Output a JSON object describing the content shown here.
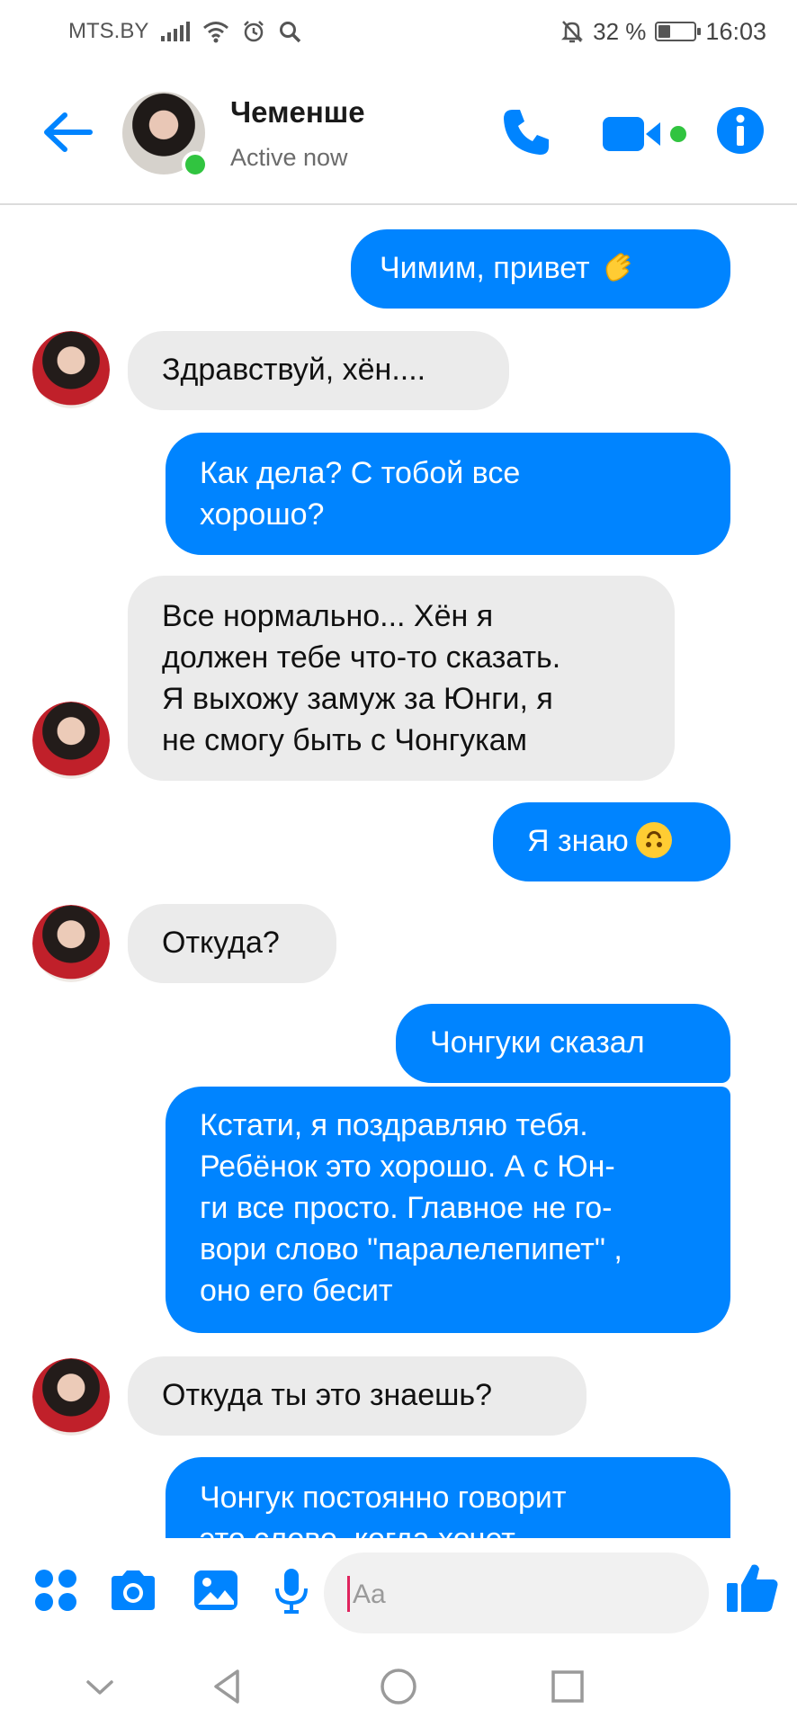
{
  "status_bar": {
    "carrier": "MTS.BY",
    "battery_percent": "32 %",
    "battery_level": 0.32,
    "time": "16:03"
  },
  "header": {
    "contact_name": "Чеменше",
    "contact_status": "Active now"
  },
  "messages": [
    {
      "dir": "out",
      "text": "Чимим, привет",
      "emoji": "waving-hand-icon"
    },
    {
      "dir": "in",
      "text": "Здравствуй, хён...."
    },
    {
      "dir": "out",
      "lines": [
        "Как дела? С тобой все",
        "хорошо?"
      ]
    },
    {
      "dir": "in",
      "lines": [
        "Все нормально... Хён я",
        "должен тебе что-то сказать.",
        "Я выхожу замуж за Юнги, я",
        "не смогу быть с Чонгукам"
      ]
    },
    {
      "dir": "out",
      "text": "Я знаю",
      "emoji": "upside-down-face-icon"
    },
    {
      "dir": "in",
      "text": "Откуда?"
    },
    {
      "dir": "out",
      "text": "Чонгуки сказал"
    },
    {
      "dir": "out",
      "lines": [
        "Кстати, я поздравляю тебя.",
        "Ребёнок это хорошо. А с Юн-",
        "ги все просто. Главное не го-",
        "вори слово \"паралелепипет\" ,",
        "оно его бесит"
      ]
    },
    {
      "dir": "in",
      "text": "Откуда ты это знаешь?"
    },
    {
      "dir": "out",
      "lines": [
        "Чонгук постоянно говорит",
        "это слово, когда хочет"
      ]
    }
  ],
  "composer": {
    "placeholder": "Aa"
  },
  "colors": {
    "accent": "#0084ff",
    "incoming_bubble": "#ebebeb",
    "online": "#31c440"
  }
}
